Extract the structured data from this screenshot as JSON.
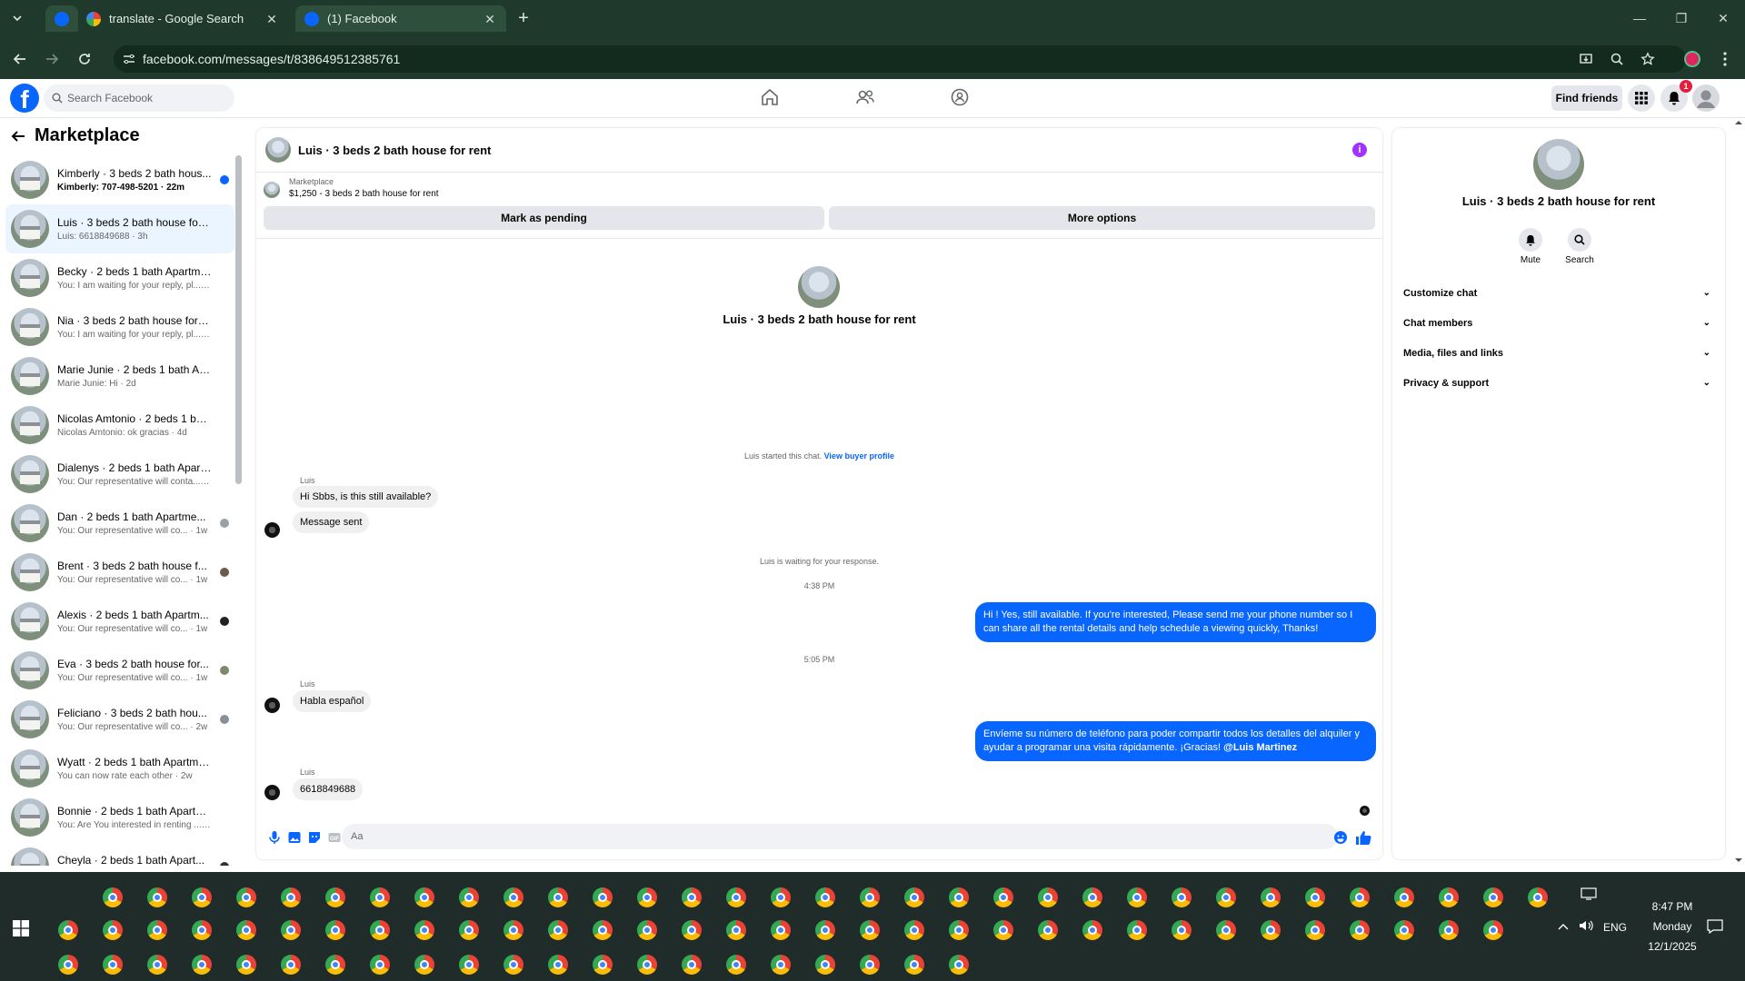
{
  "browser": {
    "tabs": [
      {
        "title": "translate - Google Search",
        "active": false
      },
      {
        "title": "(1) Facebook",
        "active": true
      }
    ],
    "new_tab_symbol": "+",
    "url": "facebook.com/messages/t/838649512385761"
  },
  "fb": {
    "search_placeholder": "Search Facebook",
    "find_friends": "Find friends",
    "notif_count": "1"
  },
  "left": {
    "title": "Marketplace",
    "conversations": [
      {
        "name": "Kimberly · 3 beds 2 bath hous...",
        "preview": "Kimberly: 707-498-5201 · 22m",
        "unread": true,
        "marker": "#0866ff"
      },
      {
        "name": "Luis · 3 beds 2 bath house for r...",
        "preview": "Luis: 6618849688 · 3h",
        "selected": true
      },
      {
        "name": "Becky · 2 beds 1 bath Apartmen...",
        "preview": "You: I am waiting for your reply, pl... · 4h"
      },
      {
        "name": "Nia · 3 beds 2 bath house for rent",
        "preview": "You: I am waiting for your reply, pl... · 4h"
      },
      {
        "name": "Marie Junie · 2 beds 1 bath Apa...",
        "preview": "Marie Junie: Hi · 2d"
      },
      {
        "name": "Nicolas Amtonio · 2 beds 1 bath...",
        "preview": "Nicolas Amtonio: ok gracias · 4d"
      },
      {
        "name": "Dialenys · 2 beds 1 bath Apartm...",
        "preview": "You: Our representative will conta... · 6d"
      },
      {
        "name": "Dan · 2 beds 1 bath Apartme...",
        "preview": "You: Our representative will co... · 1w",
        "marker": "#9aa0a6"
      },
      {
        "name": "Brent · 3 beds 2 bath house f...",
        "preview": "You: Our representative will co... · 1w",
        "marker": "#6b5b4b"
      },
      {
        "name": "Alexis · 2 beds 1 bath Apartm...",
        "preview": "You: Our representative will co... · 1w",
        "marker": "#222222"
      },
      {
        "name": "Eva · 3 beds 2 bath house for...",
        "preview": "You: Our representative will co... · 1w",
        "marker": "#7a8a6a"
      },
      {
        "name": "Feliciano · 3 beds 2 bath hou...",
        "preview": "You: Our representative will co... · 2w",
        "marker": "#8a8f9a"
      },
      {
        "name": "Wyatt · 2 beds 1 bath Apartmen...",
        "preview": "You can now rate each other · 2w"
      },
      {
        "name": "Bonnie · 2 beds 1 bath Apartme...",
        "preview": "You: Are You interested in renting ... · 2w"
      },
      {
        "name": "Cheyla · 2 beds 1 bath Apart...",
        "preview": "You: Are You interested in renti... · 2w",
        "marker": "#333333"
      }
    ]
  },
  "chat": {
    "title": "Luis · 3 beds 2 bath house for rent",
    "listing_source": "Marketplace",
    "listing_title": "$1,250 - 3 beds 2 bath house for rent",
    "mark_pending": "Mark as pending",
    "more_options": "More options",
    "intro_title": "Luis · 3 beds 2 bath house for rent",
    "started_text": "Luis started this chat.",
    "view_profile": "View buyer profile",
    "sender_name": "Luis",
    "msg1": "Hi Sbbs, is this still available?",
    "msg2": "Message sent",
    "waiting": "Luis is waiting for your response.",
    "time1": "4:38 PM",
    "out1": "Hi ! Yes, still available. If you're interested, Please send me your phone number so I can share all the rental details and help schedule a viewing quickly, Thanks!",
    "time2": "5:05 PM",
    "msg3": "Habla español",
    "out2_text": "Envíeme su número de teléfono para poder compartir todos los detalles del alquiler y ayudar a programar una visita rápidamente. ¡Gracias! ",
    "out2_mention": "@Luis Martinez",
    "msg4": "6618849688",
    "composer_placeholder": "Aa"
  },
  "right": {
    "name": "Luis · 3 beds 2 bath house for rent",
    "mute": "Mute",
    "search": "Search",
    "rows": [
      "Customize chat",
      "Chat members",
      "Media, files and links",
      "Privacy & support"
    ]
  },
  "taskbar": {
    "time": "8:47 PM",
    "day": "Monday",
    "date": "12/1/2025",
    "lang": "ENG"
  },
  "colors": {
    "fb_blue": "#0866ff",
    "browser_frame": "#1f3a2c",
    "taskbar": "#1f2c2a"
  }
}
